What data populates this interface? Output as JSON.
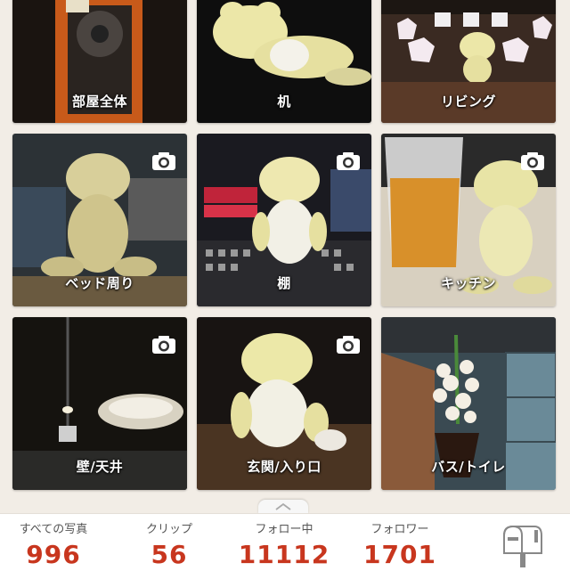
{
  "rooms": [
    {
      "label": "部屋全体"
    },
    {
      "label": "机"
    },
    {
      "label": "リビング"
    },
    {
      "label": "ベッド周り"
    },
    {
      "label": "棚"
    },
    {
      "label": "キッチン"
    },
    {
      "label": "壁/天井"
    },
    {
      "label": "玄関/入り口"
    },
    {
      "label": "バス/トイレ"
    }
  ],
  "stats": {
    "all_photos": {
      "label": "すべての写真",
      "value": "996"
    },
    "clips": {
      "label": "クリップ",
      "value": "56"
    },
    "following": {
      "label": "フォロー中",
      "value": "11112"
    },
    "followers": {
      "label": "フォロワー",
      "value": "1701"
    }
  },
  "colors": {
    "accent": "#c8361e",
    "background": "#f2ede6"
  },
  "icons": {
    "camera": "camera-icon",
    "mailbox": "mailbox-icon",
    "pull_up": "chevron-up-icon"
  }
}
